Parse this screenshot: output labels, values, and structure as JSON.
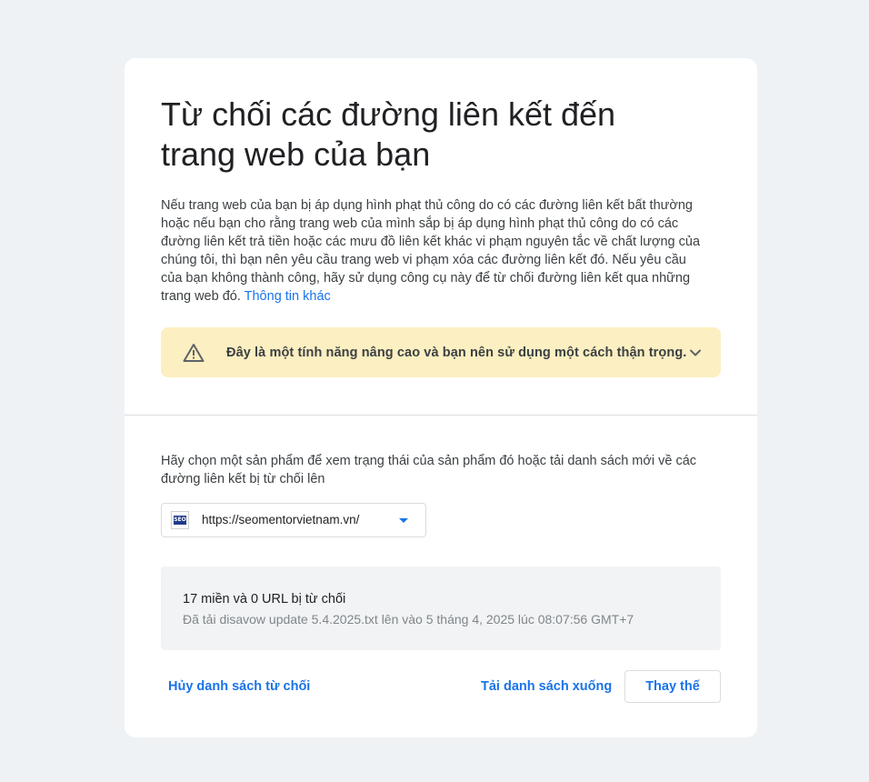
{
  "page": {
    "title": "Từ chối các đường liên kết đến trang web của bạn",
    "intro_text": "Nếu trang web của bạn bị áp dụng hình phạt thủ công do có các đường liên kết bất thường hoặc nếu bạn cho rằng trang web của mình sắp bị áp dụng hình phạt thủ công do có các đường liên kết trả tiền hoặc các mưu đồ liên kết khác vi phạm nguyên tắc về chất lượng của chúng tôi, thì bạn nên yêu cầu trang web vi phạm xóa các đường liên kết đó. Nếu yêu cầu của bạn không thành công, hãy sử dụng công cụ này để từ chối đường liên kết qua những trang web đó. ",
    "learn_more_link": "Thông tin khác"
  },
  "warning": {
    "text": "Đây là một tính năng nâng cao và bạn nên sử dụng một cách thận trọng.",
    "icon": "warning-icon",
    "color": "#fcefc1"
  },
  "property": {
    "prompt": "Hãy chọn một sản phẩm để xem trạng thái của sản phẩm đó hoặc tải danh sách mới về các đường liên kết bị từ chối lên",
    "selected": "https://seomentorvietnam.vn/",
    "favicon_text": "SEO"
  },
  "status": {
    "count_text": "17 miền và 0 URL bị từ chối",
    "detail_text": "Đã tải disavow update 5.4.2025.txt lên vào 5 tháng 4, 2025 lúc 08:07:56 GMT+7"
  },
  "actions": {
    "cancel_label": "Hủy danh sách từ chối",
    "download_label": "Tải danh sách xuống",
    "replace_label": "Thay thế"
  },
  "colors": {
    "accent": "#1a73e8",
    "background": "#eff2f5"
  }
}
